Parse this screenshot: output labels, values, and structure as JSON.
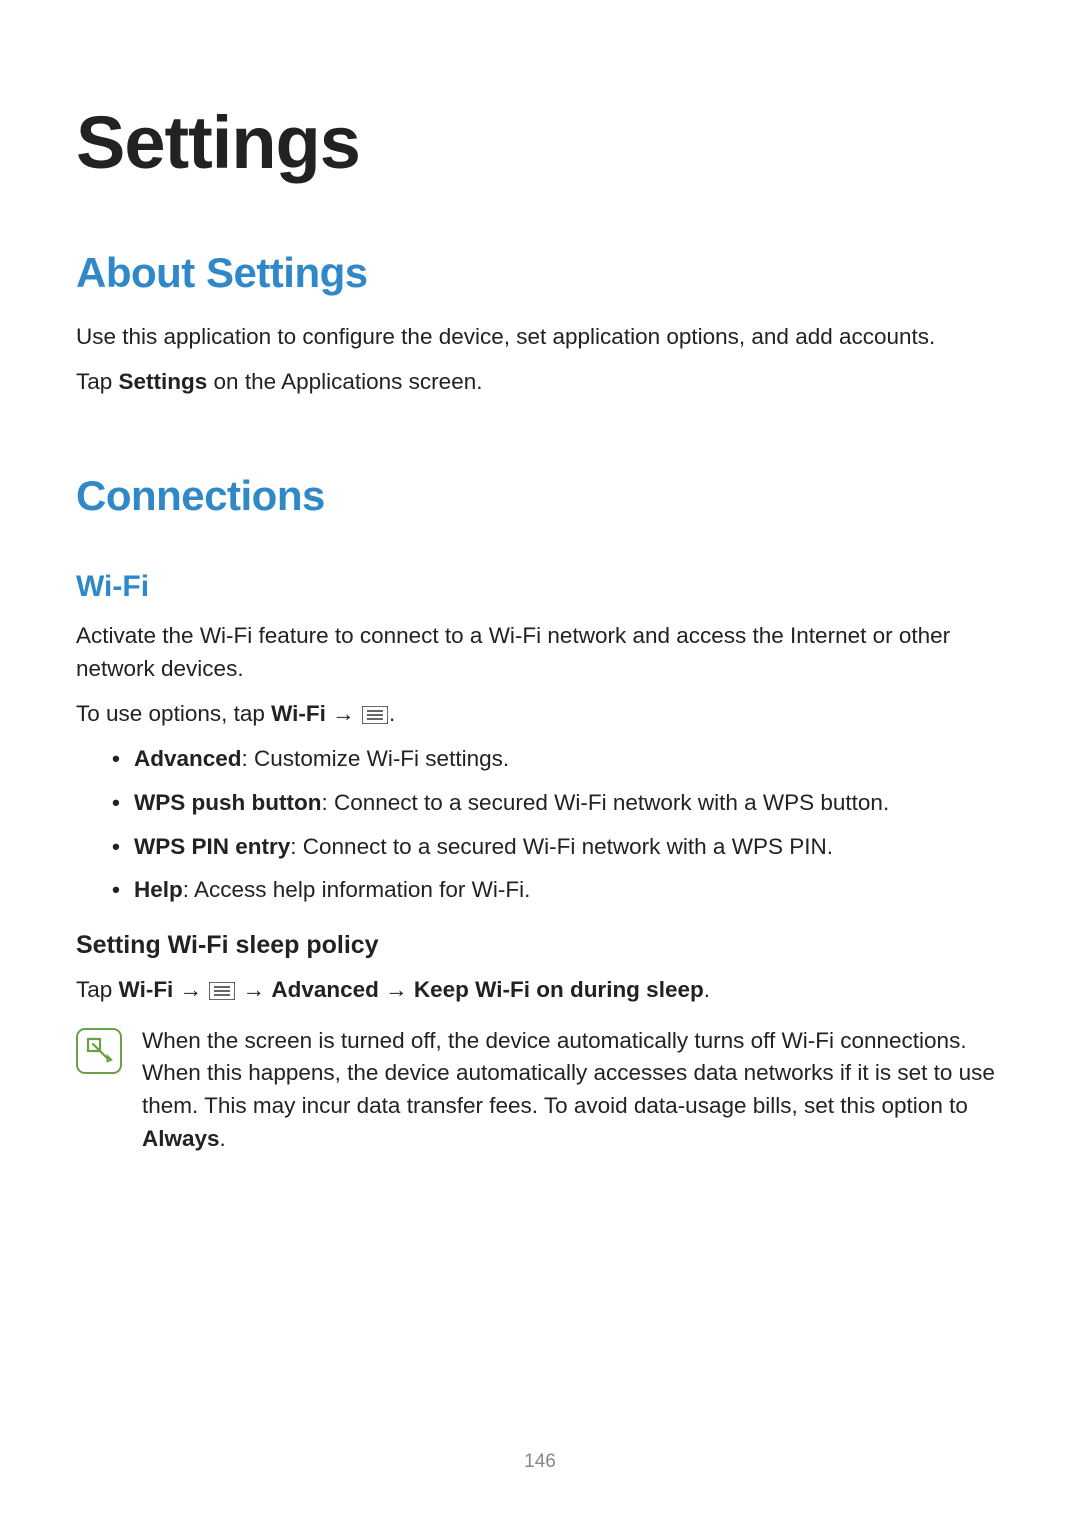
{
  "page": {
    "title": "Settings",
    "number": "146"
  },
  "about": {
    "heading": "About Settings",
    "p1": "Use this application to configure the device, set application options, and add accounts.",
    "p2_pre": "Tap ",
    "p2_bold": "Settings",
    "p2_post": " on the Applications screen."
  },
  "connections": {
    "heading": "Connections"
  },
  "wifi": {
    "heading": "Wi-Fi",
    "intro": "Activate the Wi-Fi feature to connect to a Wi-Fi network and access the Internet or other network devices.",
    "options_pre": "To use options, tap ",
    "options_bold": "Wi-Fi",
    "options_arrow": " → ",
    "options_period": ".",
    "bullets": [
      {
        "label": "Advanced",
        "desc": ": Customize Wi-Fi settings."
      },
      {
        "label": "WPS push button",
        "desc": ": Connect to a secured Wi-Fi network with a WPS button."
      },
      {
        "label": "WPS PIN entry",
        "desc": ": Connect to a secured Wi-Fi network with a WPS PIN."
      },
      {
        "label": "Help",
        "desc": ": Access help information for Wi-Fi."
      }
    ],
    "sleep": {
      "title": "Setting Wi-Fi sleep policy",
      "path_pre": "Tap ",
      "wf": "Wi-Fi",
      "arr1": " → ",
      "arr2": " → ",
      "adv": "Advanced",
      "arr3": " → ",
      "keep": "Keep Wi-Fi on during sleep",
      "period": ".",
      "note_body": "When the screen is turned off, the device automatically turns off Wi-Fi connections. When this happens, the device automatically accesses data networks if it is set to use them. This may incur data transfer fees. To avoid data-usage bills, set this option to ",
      "note_bold": "Always",
      "note_period": "."
    }
  }
}
